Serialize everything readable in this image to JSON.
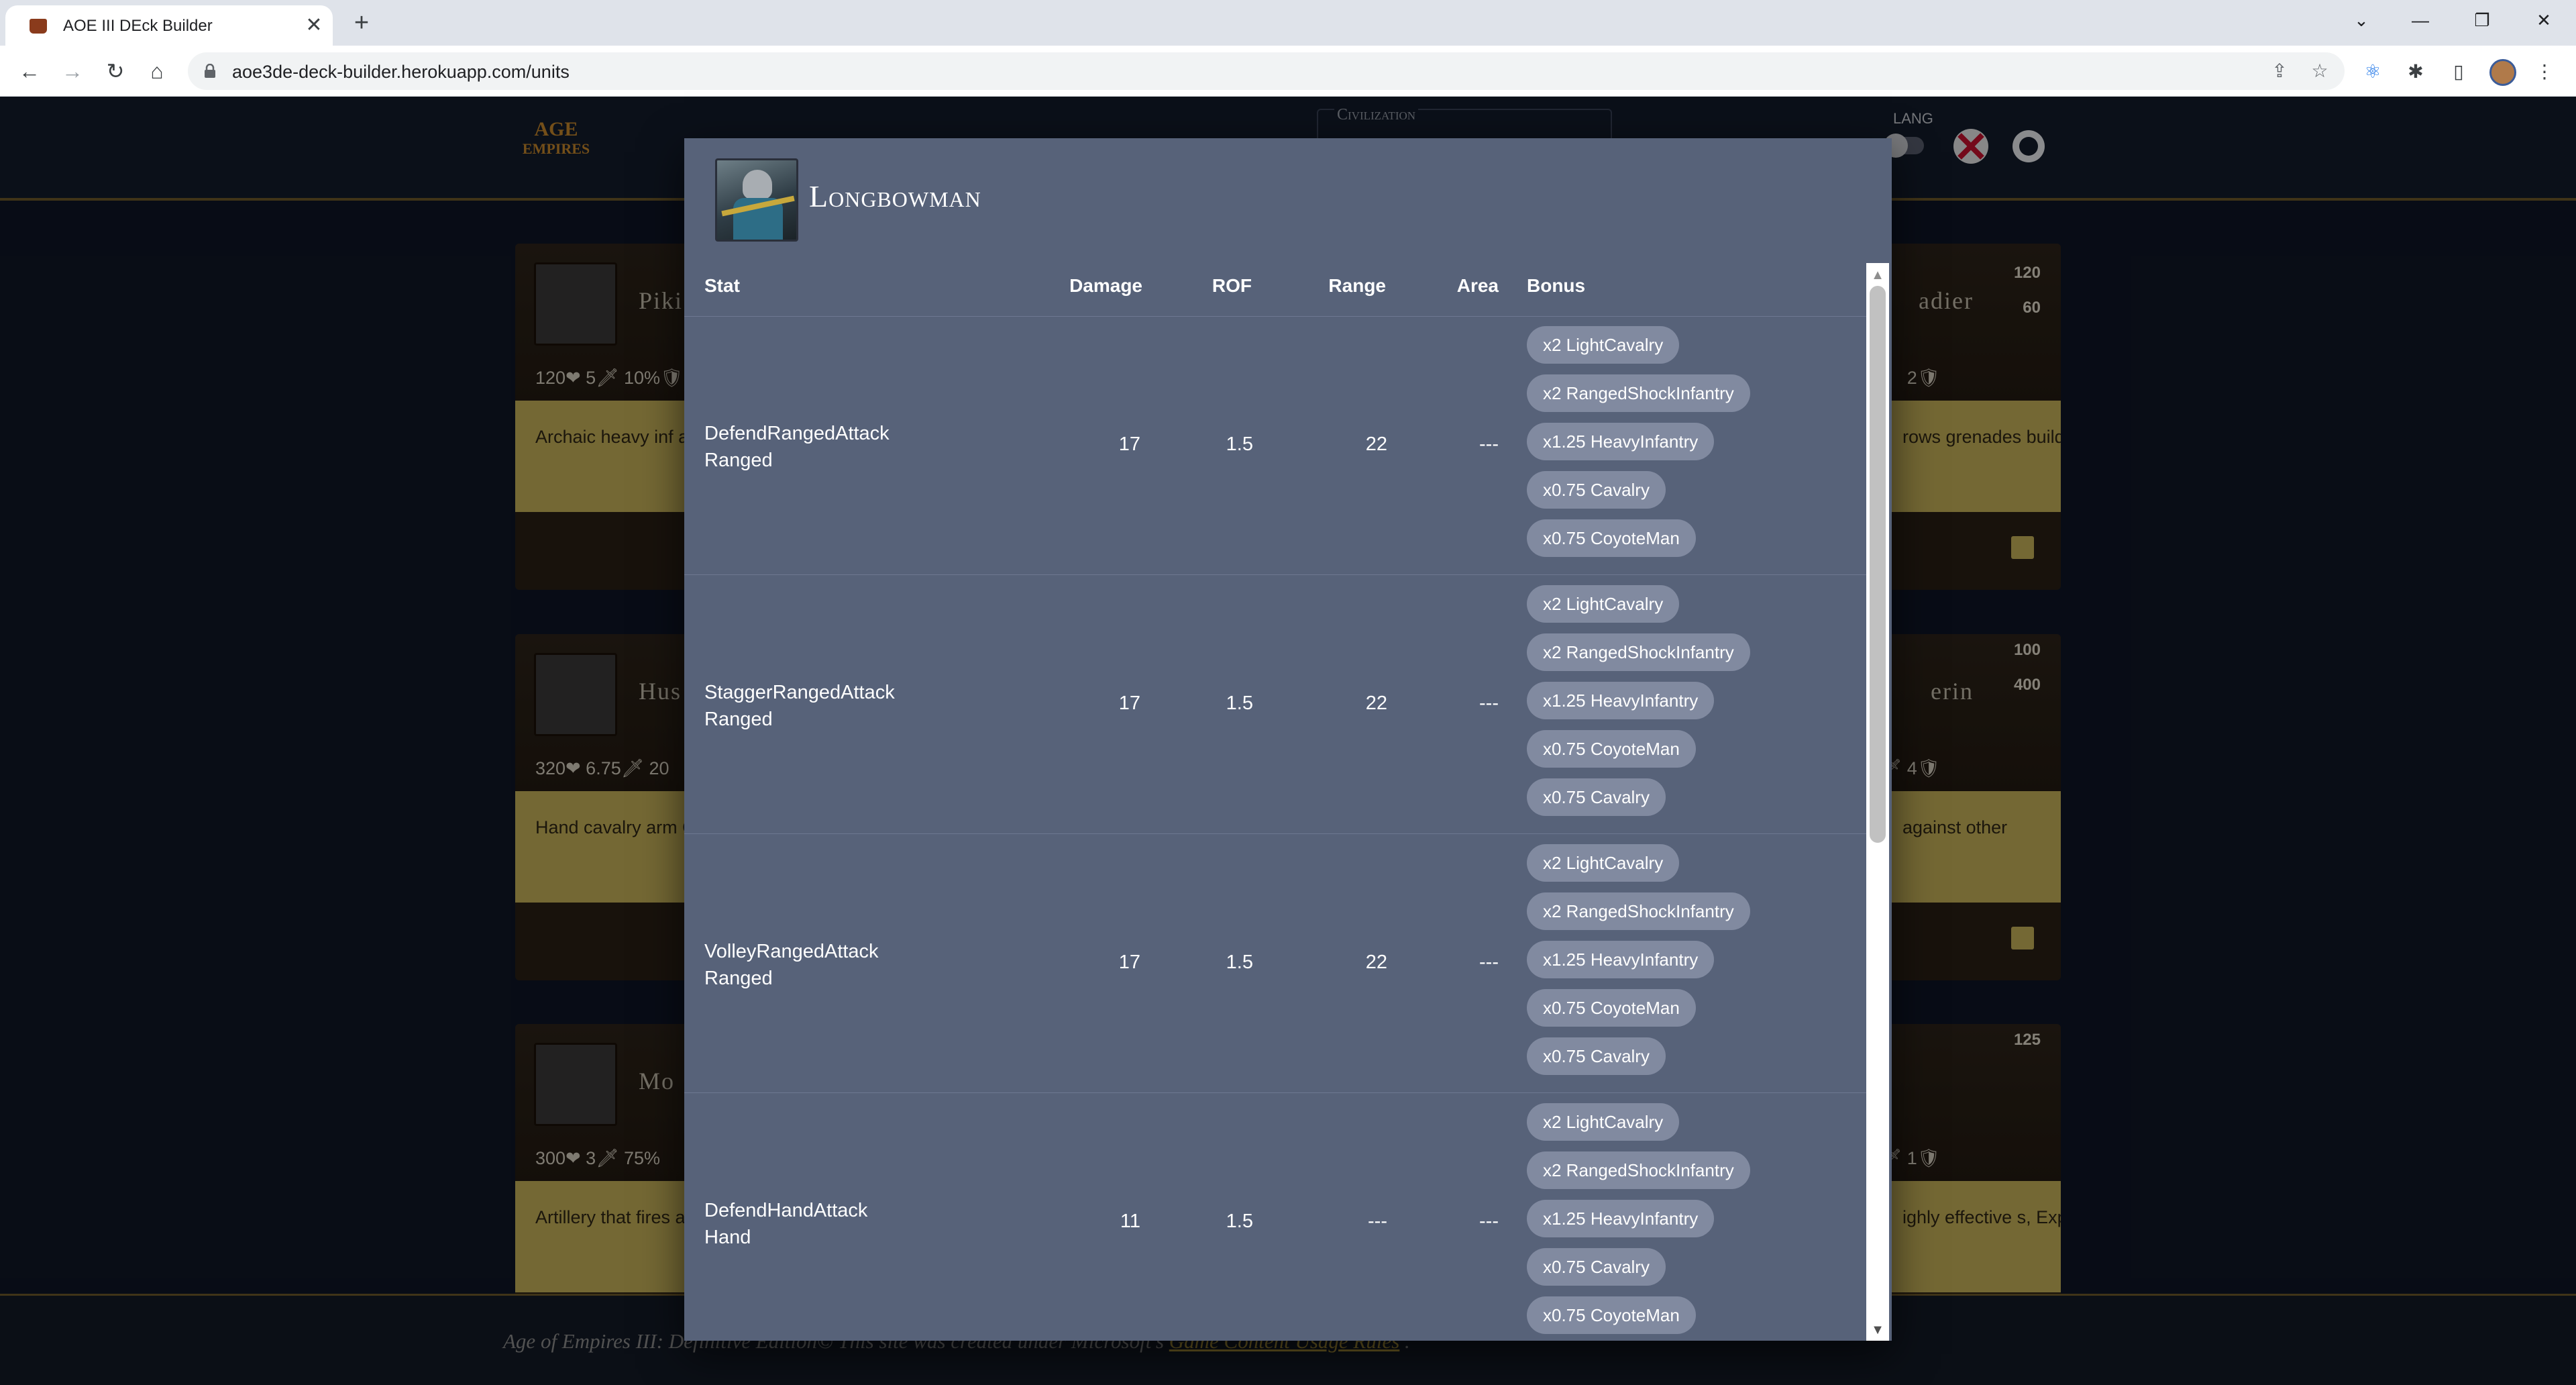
{
  "browser": {
    "tab_title": "AOE III DEck Builder",
    "tab_close": "✕",
    "new_tab": "+",
    "url": "aoe3de-deck-builder.herokuapp.com/units",
    "back": "←",
    "forward": "→",
    "reload": "↻",
    "home": "⌂",
    "minimize": "—",
    "maximize": "❐",
    "close": "✕",
    "tab_list": "⌄"
  },
  "app": {
    "logo_line1": "AGE",
    "logo_line2": "EMPIRES",
    "civilization_label": "Civilization",
    "lang_label": "LANG"
  },
  "cards": [
    {
      "name": "Piki",
      "stats": "120❤ 5🗡 10%🛡",
      "desc": "Archaic heavy inf against cavalry ar",
      "right_name": "adier",
      "right_cost_1": "120",
      "right_cost_2": "60",
      "right_stat": "2🛡",
      "right_desc": "rows grenades buildings."
    },
    {
      "name": "Hus",
      "stats": "320❤ 6.75🗡 20",
      "desc": "Hand cavalry arm Good against ligh",
      "right_name": "erin",
      "right_cost_1": "100",
      "right_cost_2": "400",
      "right_stat": "🗡 4🛡",
      "right_desc": "against other"
    },
    {
      "name": "Mo",
      "stats": "300❤ 3🗡 75%",
      "desc": "Artillery that fires at buildings or shi",
      "right_name": "",
      "right_cost_1": "125",
      "right_cost_2": "",
      "right_stat": "🗡 1🛡",
      "right_desc": "ighly effective s, Explorers, War"
    }
  ],
  "footer": {
    "text_before": "Age of Empires III: Definitive Edition© This site was created under Microsoft's ",
    "link": "Game Content Usage Rules",
    "text_after": "."
  },
  "modal": {
    "unit_name": "Longbowman",
    "columns": [
      "Stat",
      "Damage",
      "ROF",
      "Range",
      "Area",
      "Bonus"
    ],
    "rows": [
      {
        "stat_line1": "DefendRangedAttack",
        "stat_line2": "Ranged",
        "damage": "17",
        "rof": "1.5",
        "range": "22",
        "area": "---",
        "bonus": [
          "x2 LightCavalry",
          "x2 RangedShockInfantry",
          "x1.25 HeavyInfantry",
          "x0.75 Cavalry",
          "x0.75 CoyoteMan"
        ]
      },
      {
        "stat_line1": "StaggerRangedAttack",
        "stat_line2": "Ranged",
        "damage": "17",
        "rof": "1.5",
        "range": "22",
        "area": "---",
        "bonus": [
          "x2 LightCavalry",
          "x2 RangedShockInfantry",
          "x1.25 HeavyInfantry",
          "x0.75 CoyoteMan",
          "x0.75 Cavalry"
        ]
      },
      {
        "stat_line1": "VolleyRangedAttack",
        "stat_line2": "Ranged",
        "damage": "17",
        "rof": "1.5",
        "range": "22",
        "area": "---",
        "bonus": [
          "x2 LightCavalry",
          "x2 RangedShockInfantry",
          "x1.25 HeavyInfantry",
          "x0.75 CoyoteMan",
          "x0.75 Cavalry"
        ]
      },
      {
        "stat_line1": "DefendHandAttack",
        "stat_line2": "Hand",
        "damage": "11",
        "rof": "1.5",
        "range": "---",
        "area": "---",
        "bonus": [
          "x2 LightCavalry",
          "x2 RangedShockInfantry",
          "x1.25 HeavyInfantry",
          "x0.75 Cavalry",
          "x0.75 CoyoteMan"
        ]
      }
    ],
    "scroll_up": "▲",
    "scroll_down": "▼"
  }
}
